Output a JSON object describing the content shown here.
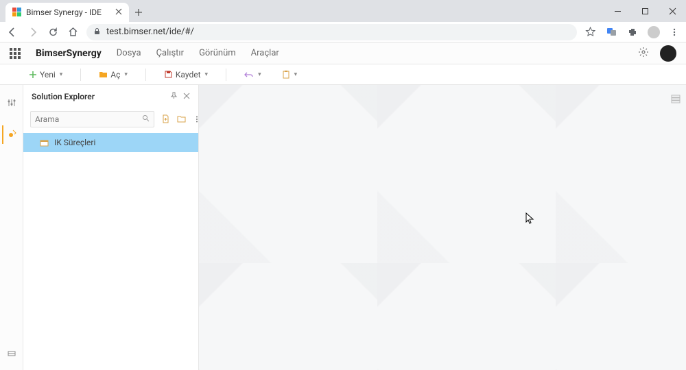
{
  "browser": {
    "tab_title": "Bimser Synergy - IDE",
    "url": "test.bimser.net/ide/#/"
  },
  "app": {
    "brand": "BimserSynergy",
    "menu": [
      "Dosya",
      "Çalıştır",
      "Görünüm",
      "Araçlar"
    ]
  },
  "toolbar": {
    "new_label": "Yeni",
    "open_label": "Aç",
    "save_label": "Kaydet"
  },
  "panel": {
    "title": "Solution Explorer",
    "search_placeholder": "Arama"
  },
  "tree": {
    "items": [
      {
        "label": "IK Süreçleri",
        "selected": true
      }
    ]
  }
}
